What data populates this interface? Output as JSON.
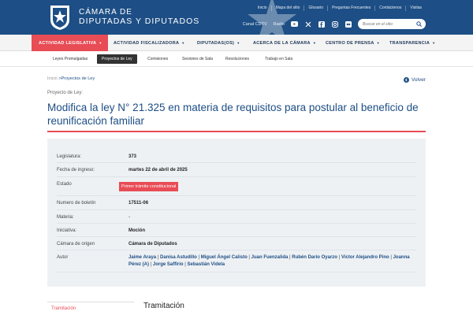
{
  "header": {
    "brand_line1": "CÁMARA DE",
    "brand_line2": "DIPUTADAS Y DIPUTADOS",
    "logo_text": "CHILE",
    "top_links": [
      "Inicio",
      "Mapa del sitio",
      "Glosario",
      "Preguntas Frecuentes",
      "Contáctenos",
      "Visitas"
    ],
    "media_links": [
      "Canal CDTV",
      "Radio"
    ],
    "social_icons": [
      "youtube-icon",
      "x-icon",
      "facebook-icon",
      "instagram-icon",
      "flickr-icon"
    ],
    "search_placeholder": "Buscar en el sitio"
  },
  "main_nav": [
    {
      "label": "ACTIVIDAD LEGISLATIVA",
      "active": true
    },
    {
      "label": "ACTIVIDAD FISCALIZADORA",
      "active": false
    },
    {
      "label": "DIPUTADAS(OS)",
      "active": false
    },
    {
      "label": "ACERCA DE LA CÁMARA",
      "active": false
    },
    {
      "label": "CENTRO DE PRENSA",
      "active": false
    },
    {
      "label": "TRANSPARENCIA",
      "active": false
    }
  ],
  "sub_nav": [
    {
      "label": "Leyes Promulgadas",
      "active": false
    },
    {
      "label": "Proyectos de Ley",
      "active": true
    },
    {
      "label": "Comisiones",
      "active": false
    },
    {
      "label": "Sesiones de Sala",
      "active": false
    },
    {
      "label": "Resoluciones",
      "active": false
    },
    {
      "label": "Trabajo en Sala",
      "active": false
    }
  ],
  "breadcrumb": {
    "home": "Inicio",
    "sep": " >",
    "current": "Proyectos de Ley"
  },
  "back_label": "Volver",
  "kind_label": "Proyecto de Ley:",
  "title": "Modifica la ley N° 21.325 en materia de requisitos para postular al beneficio de reunificación familiar",
  "details": {
    "legislatura_label": "Legislatura:",
    "legislatura": "373",
    "fecha_label": "Fecha de ingreso:",
    "fecha": "martes 22 de abril de 2025",
    "estado_label": "Estado",
    "estado": "Primer trámite constitucional",
    "boletin_label": "Numero de boletín",
    "boletin": "17511-06",
    "materia_label": "Materia:",
    "materia": "-",
    "iniciativa_label": "Iniciativa:",
    "iniciativa": "Moción",
    "camara_label": "Cámara de origen",
    "camara": "Cámara de Diputados",
    "autor_label": "Autor",
    "autores": [
      "Jaime Araya",
      "Danisa Astudillo",
      "Miguel Ángel Calisto",
      "Juan Fuenzalida",
      "Rubén Darío Oyarzo",
      "Víctor Alejandro Pino",
      "Joanna Pérez (A)",
      "Jorge Saffirio",
      "Sebastián Videla"
    ],
    "author_sep": " | "
  },
  "tramitacion_link": "Tramitación",
  "tramitacion_title": "Tramitación",
  "colors": {
    "primary": "#1d4e85",
    "accent": "#e84c55",
    "panel": "#eef1f4"
  }
}
